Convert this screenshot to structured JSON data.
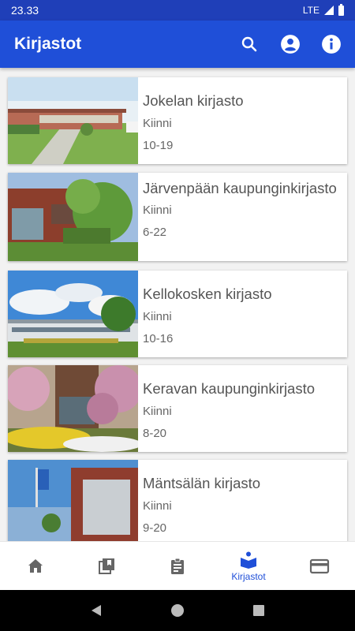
{
  "status_bar": {
    "time": "23.33",
    "network": "LTE"
  },
  "app_bar": {
    "title": "Kirjastot",
    "icons": [
      "search-icon",
      "account-icon",
      "info-icon"
    ]
  },
  "libraries": [
    {
      "name": "Jokelan kirjasto",
      "status": "Kiinni",
      "hours": "10-19",
      "image": "building-photo"
    },
    {
      "name": "Järvenpään kaupunginkirjasto",
      "status": "Kiinni",
      "hours": "6-22",
      "image": "building-photo"
    },
    {
      "name": "Kellokosken kirjasto",
      "status": "",
      "hours": "10-16",
      "image": "building-photo"
    },
    {
      "name": "Keravan kaupunginkirjasto",
      "status": "Kiinni",
      "hours": "8-20",
      "image": "building-photo"
    },
    {
      "name": "Mäntsälän kirjasto",
      "status": "Kiinni",
      "hours": "9-20",
      "image": "building-photo"
    }
  ],
  "bottom_nav": {
    "items": [
      {
        "icon": "home-icon",
        "label": ""
      },
      {
        "icon": "collections-icon",
        "label": ""
      },
      {
        "icon": "clipboard-icon",
        "label": ""
      },
      {
        "icon": "library-icon",
        "label": "Kirjastot",
        "active": true
      },
      {
        "icon": "card-icon",
        "label": ""
      }
    ]
  },
  "colors": {
    "primary": "#1f4fd8",
    "status_bar": "#1f3fb8",
    "text": "#555555"
  }
}
